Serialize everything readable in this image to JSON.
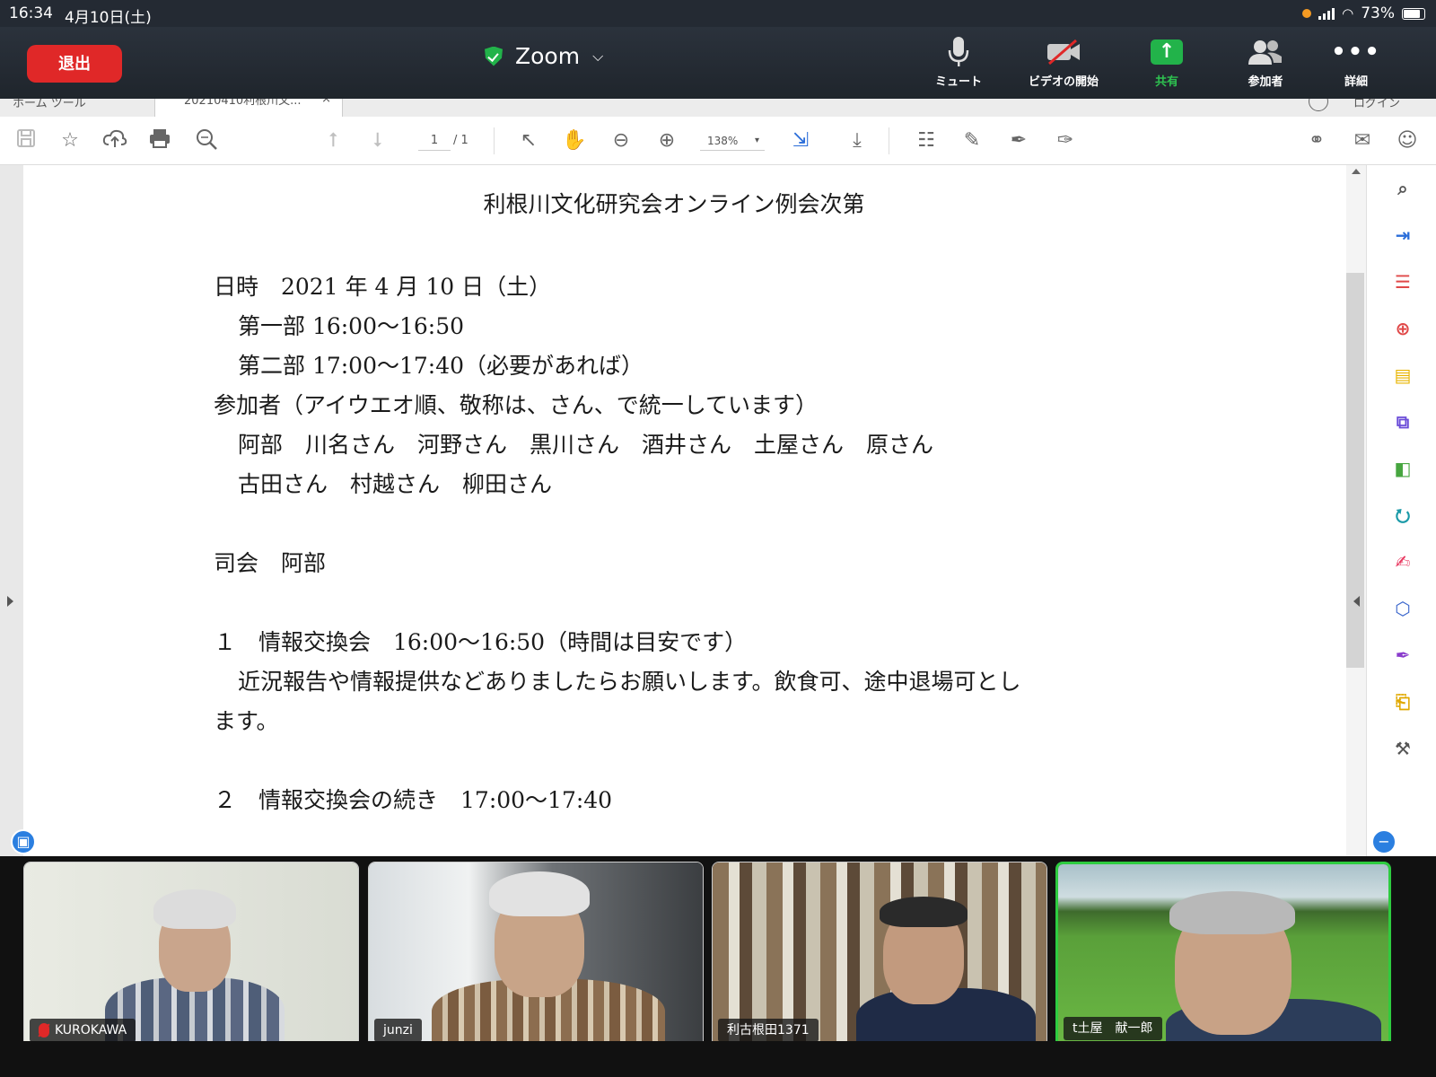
{
  "status_bar": {
    "time": "16:34",
    "date": "4月10日(土)",
    "battery": "73%",
    "battery_level": 0.73
  },
  "zoom_header": {
    "leave_label": "退出",
    "title": "Zoom",
    "controls": [
      {
        "id": "mute",
        "label": "ミュート",
        "icon": "microphone-icon"
      },
      {
        "id": "video",
        "label": "ビデオの開始",
        "icon": "video-off-icon"
      },
      {
        "id": "share",
        "label": "共有",
        "icon": "share-arrow-icon"
      },
      {
        "id": "participants",
        "label": "参加者",
        "icon": "participants-icon"
      },
      {
        "id": "more",
        "label": "詳細",
        "icon": "more-dots-icon"
      }
    ]
  },
  "pdf_app": {
    "tabs": {
      "home": "ホーム  ツール",
      "document": "20210410利根川文...",
      "close": "×",
      "login": "ログイン"
    },
    "toolbar": {
      "page_current": "1",
      "page_total": "/ 1",
      "zoom": "138%"
    }
  },
  "document": {
    "title": "利根川文化研究会オンライン例会次第",
    "lines": [
      "日時　2021 年 4 月 10 日（土）",
      "第一部 16:00〜16:50",
      "第二部 17:00〜17:40（必要があれば）",
      "参加者（アイウエオ順、敬称は、さん、で統一しています）",
      "阿部　川名さん　河野さん　黒川さん　酒井さん　土屋さん　原さん",
      "古田さん　村越さん　柳田さん",
      "司会　阿部",
      "１　情報交換会　16:00〜16:50（時間は目安です）",
      "近況報告や情報提供などありましたらお願いします。飲食可、途中退場可とし",
      "ます。",
      "２　情報交換会の続き　17:00〜17:40"
    ]
  },
  "participants": [
    {
      "name": "KUROKAWA",
      "muted": true
    },
    {
      "name": "junzi",
      "muted": false
    },
    {
      "name": "利古根田1371",
      "muted": false
    },
    {
      "name": "t土屋　献一郎",
      "muted": false,
      "active_speaker": true
    }
  ],
  "colors": {
    "leave": "#e02828",
    "share": "#22b34a",
    "active_border": "#2ecc40",
    "accent_blue": "#2a6dd9"
  }
}
